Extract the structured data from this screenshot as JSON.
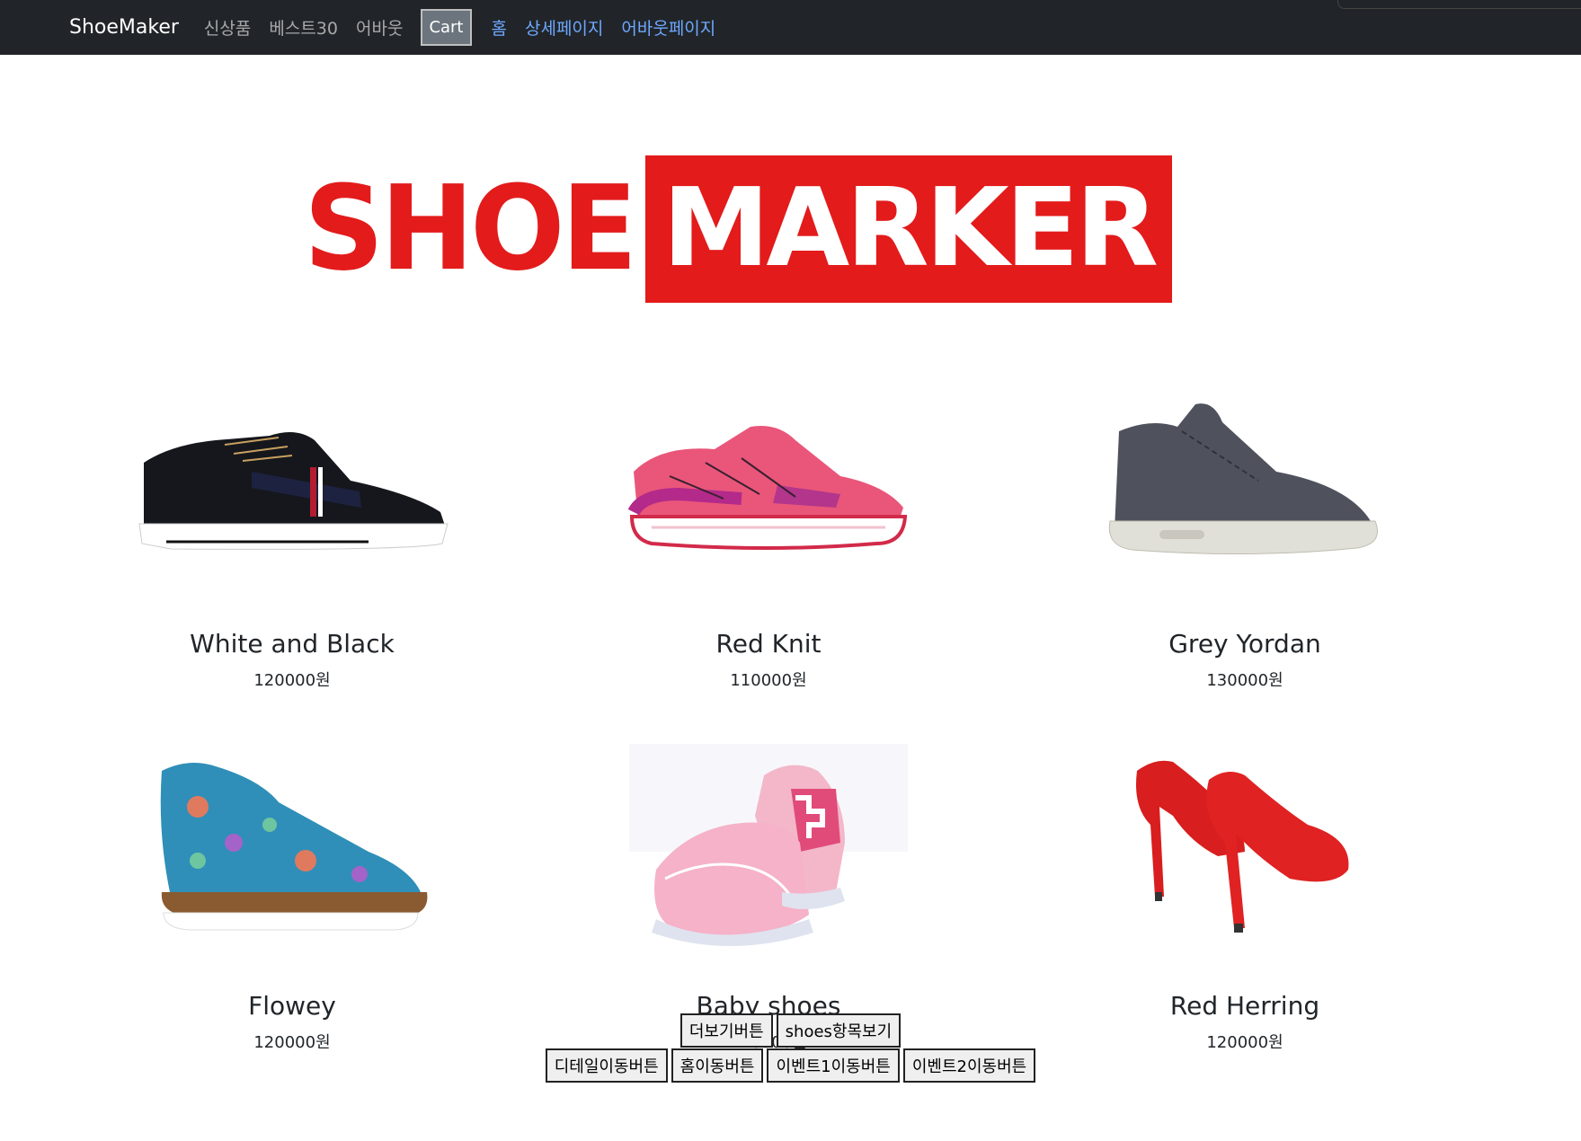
{
  "navbar": {
    "brand": "ShoeMaker",
    "links": [
      "신상품",
      "베스트30",
      "어바웃"
    ],
    "cart_label": "Cart",
    "router_links": [
      "홈",
      "상세페이지",
      "어바웃페이지"
    ]
  },
  "logo": {
    "left_text": "SHOE",
    "right_text": "MARKER",
    "color": "#e31b1b"
  },
  "products": [
    {
      "name": "White and Black",
      "price": "120000원"
    },
    {
      "name": "Red Knit",
      "price": "110000원"
    },
    {
      "name": "Grey Yordan",
      "price": "130000원"
    },
    {
      "name": "Flowey",
      "price": "120000원"
    },
    {
      "name": "Baby shoes",
      "price": "120000원"
    },
    {
      "name": "Red Herring",
      "price": "120000원"
    }
  ],
  "buttons": {
    "row1": [
      "더보기버튼",
      "shoes항목보기"
    ],
    "row2": [
      "디테일이동버튼",
      "홈이동버튼",
      "이벤트1이동버튼",
      "이벤트2이동버튼"
    ]
  }
}
